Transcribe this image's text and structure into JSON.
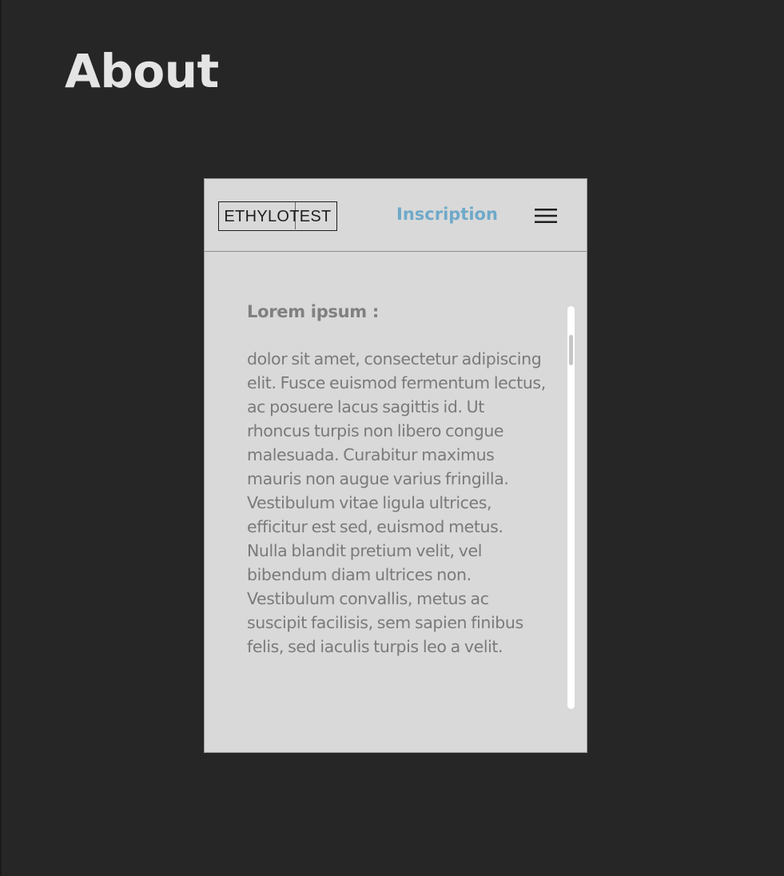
{
  "page": {
    "title": "About"
  },
  "app": {
    "logo_text": "ETHYLOTEST",
    "signup_label": "Inscription",
    "menu_icon": "hamburger-menu-icon",
    "accent_color": "#6ea9c9"
  },
  "content": {
    "heading": "Lorem ipsum :",
    "body": "dolor sit amet, consectetur adipiscing elit. Fusce euismod fermentum lectus, ac posuere lacus sagittis id. Ut rhoncus turpis non libero congue malesuada. Curabitur maximus mauris non augue varius fringilla. Vestibulum vitae ligula ultrices, efficitur est sed, euismod metus. Nulla blandit pretium velit, vel bibendum diam ultrices non. Vestibulum convallis, metus ac suscipit facilisis, sem sapien finibus felis, sed iaculis turpis leo a velit."
  }
}
